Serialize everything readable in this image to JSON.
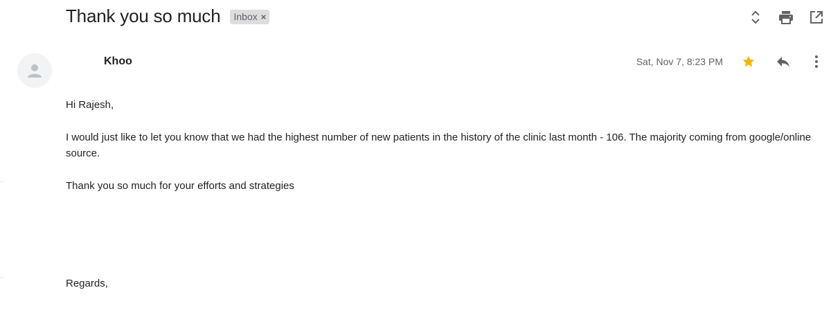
{
  "subject": {
    "title": "Thank you so much",
    "label": "Inbox",
    "label_close": "×"
  },
  "toolbar": {
    "icons": [
      "expand-collapse-icon",
      "print-icon",
      "open-in-new-window-icon"
    ]
  },
  "message": {
    "sender_name": "Khoo",
    "date": "Sat, Nov 7, 8:23 PM",
    "starred": true,
    "icons": [
      "star-icon",
      "reply-icon",
      "more-options-icon"
    ],
    "body": {
      "greeting": "Hi Rajesh,",
      "paragraph1": "I would just like to let you know that we had the highest number of new patients in the history of the clinic last month - 106. The majority coming from google/online source.",
      "paragraph2": "Thank you so much for your efforts and strategies",
      "closing": "Regards,"
    }
  },
  "colors": {
    "star": "#f4b400",
    "icon": "#5f6368",
    "chip_bg": "#dddddd"
  }
}
